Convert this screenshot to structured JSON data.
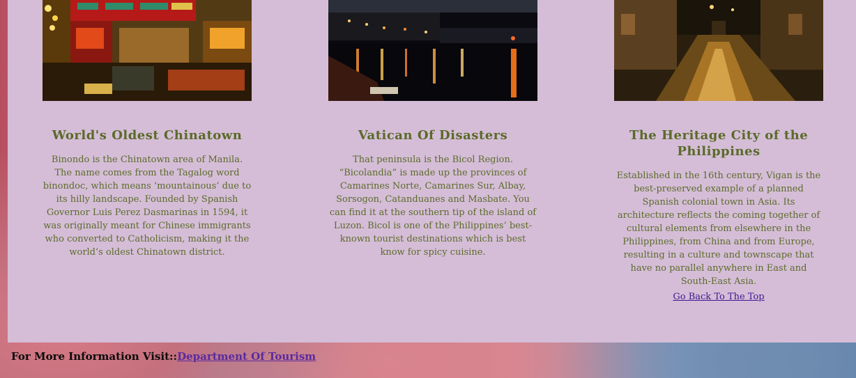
{
  "cards": [
    {
      "image_alt": "Binondo Chinatown at night",
      "title": "World's Oldest Chinatown",
      "text": "Binondo is the Chinatown area of Manila. The name comes from the Tagalog word binondoc, which means ‘mountainous’ due to its hilly landscape. Founded by Spanish Governor Luis Perez Dasmarinas in 1594, it was originally meant for Chinese immigrants who converted to Catholicism, making it the world’s oldest Chinatown district."
    },
    {
      "image_alt": "Bicol harbor at night",
      "title": "Vatican Of Disasters",
      "text": "That peninsula is the Bicol Region. “Bicolandia” is made up the provinces of Camarines Norte, Camarines Sur, Albay, Sorsogon, Catanduanes and Masbate. You can find it at the southern tip of the island of Luzon. Bicol is one of the Philippines’ best-known tourist destinations which is best know for spicy cuisine."
    },
    {
      "image_alt": "Vigan cobblestone street at night",
      "title": "The Heritage City of the Philippines",
      "text": "Established in the 16th century, Vigan is the best-preserved example of a planned Spanish colonial town in Asia. Its architecture reflects the coming together of cultural elements from elsewhere in the Philippines, from China and from Europe, resulting in a culture and townscape that have no parallel anywhere in East and South-East Asia."
    }
  ],
  "back_to_top": "Go Back To The Top",
  "footer": {
    "prefix": "For More Information Visit::",
    "link": "Department Of Tourism"
  }
}
